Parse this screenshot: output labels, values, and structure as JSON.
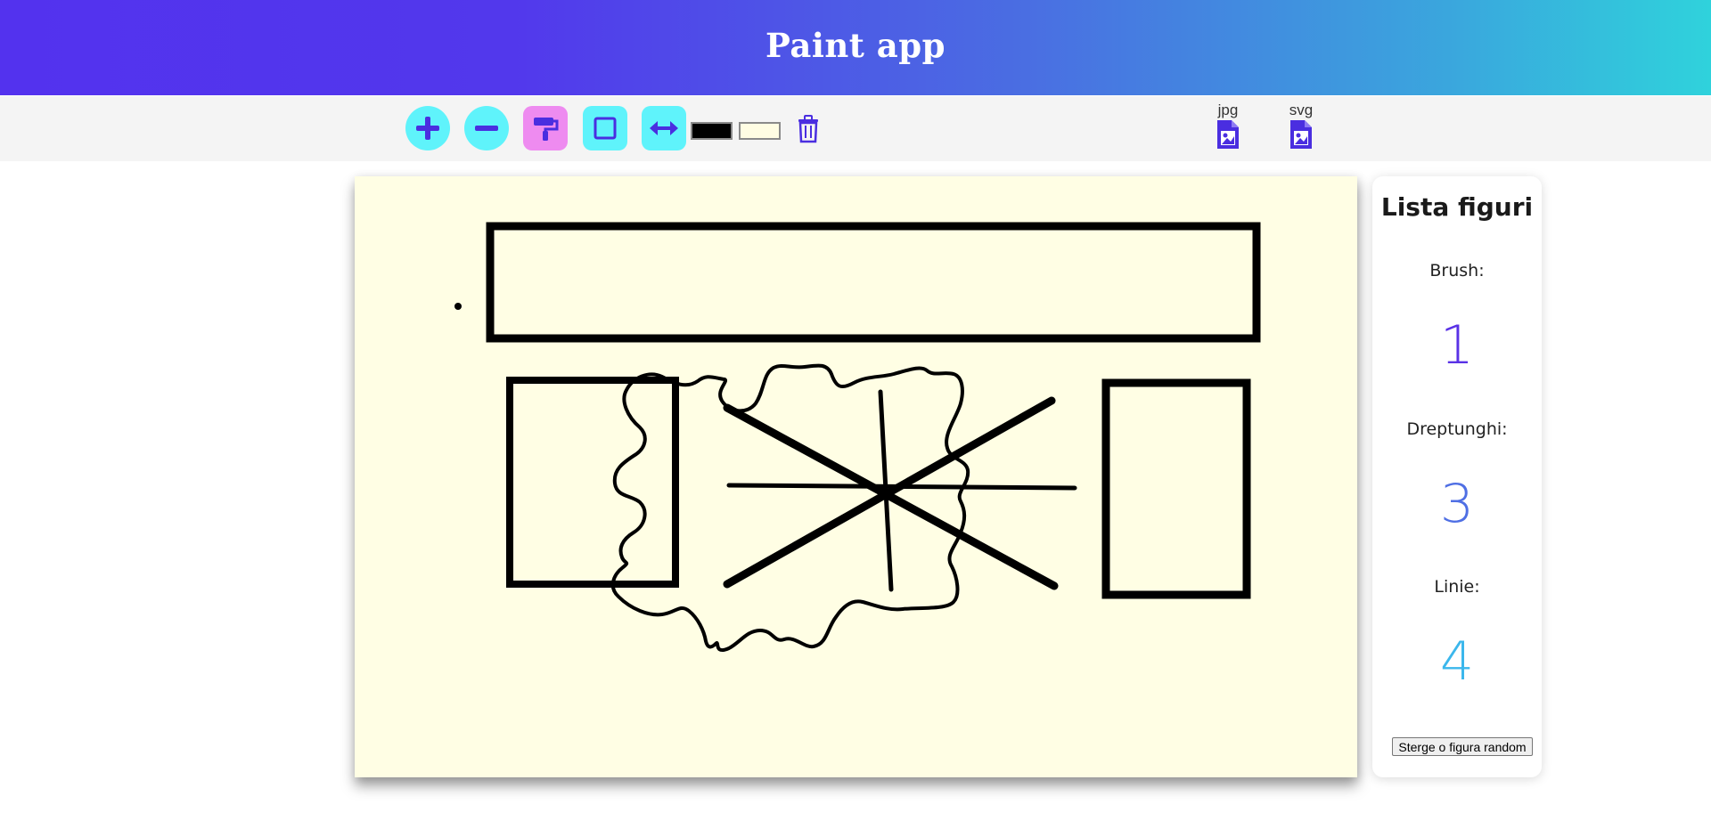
{
  "header": {
    "title": "Paint app"
  },
  "toolbar": {
    "tools": [
      {
        "name": "add",
        "icon": "plus-icon"
      },
      {
        "name": "remove",
        "icon": "minus-icon"
      },
      {
        "name": "brush",
        "icon": "paint-roller-icon"
      },
      {
        "name": "rectangle",
        "icon": "square-icon"
      },
      {
        "name": "line",
        "icon": "horizontal-arrows-icon"
      }
    ],
    "stroke_color": "#000000",
    "fill_color": "#fffde3",
    "delete_icon": "trash-icon",
    "export": {
      "jpg_label": "jpg",
      "svg_label": "svg"
    }
  },
  "colors": {
    "accent": "#5332ee",
    "cyan": "#5ff3fb",
    "pink": "#ee8bf0",
    "canvas": "#fffee4"
  },
  "panel": {
    "title": "Lista figuri",
    "brush_label": "Brush:",
    "brush_count": "1",
    "rect_label": "Dreptunghi:",
    "rect_count": "3",
    "line_label": "Linie:",
    "line_count": "4",
    "delete_random_label": "Sterge o figura random"
  }
}
